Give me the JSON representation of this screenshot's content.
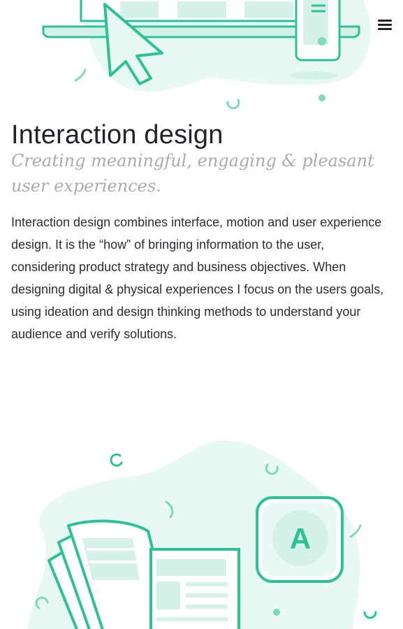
{
  "nav": {
    "menu_icon": "hamburger-menu-icon"
  },
  "section": {
    "title": "Interaction design",
    "subtitle": "Creating meaningful, engaging & pleasant user experiences.",
    "body": "Interaction design combines interface, motion and user experience design. It is the “how” of bringing information to the user, considering product strategy and business objectives. When designing digital & physical experiences I focus on the users goals, using ideation and design thinking methods to understand your audience and verify solutions."
  },
  "illustrations": {
    "top": "laptop-cursor-phone-illustration",
    "bottom": "newspaper-document-badge-illustration",
    "badge_letter": "A"
  },
  "colors": {
    "accent": "#2cc295",
    "accent_light": "#d6f2e8",
    "blob": "#e8f8f2",
    "title": "#20242a",
    "subtitle": "#a8acaf",
    "body": "#2a2e33"
  }
}
